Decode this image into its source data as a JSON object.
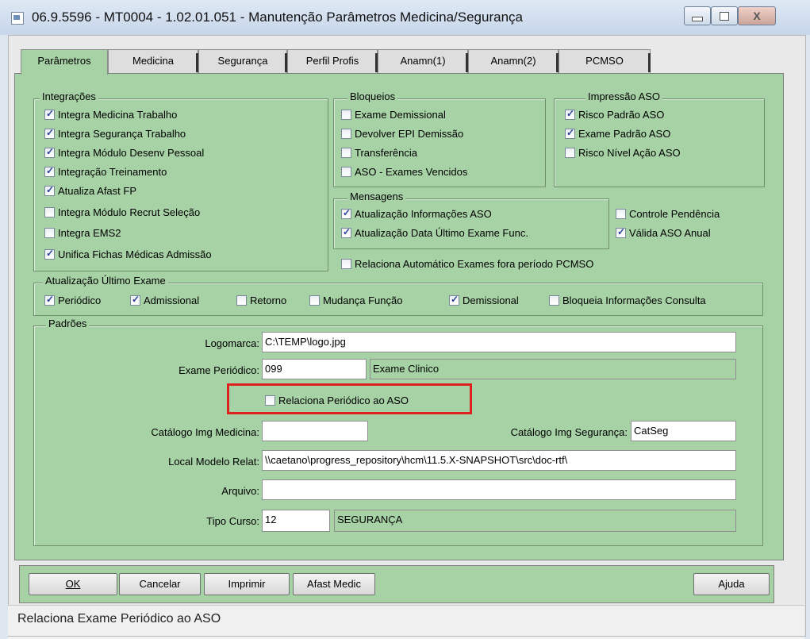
{
  "window": {
    "title": "06.9.5596 - MT0004 - 1.02.01.051 - Manutenção Parâmetros Medicina/Segurança",
    "close_glyph": "X"
  },
  "tabs": [
    "Parâmetros",
    "Medicina",
    "Segurança",
    "Perfil Profis",
    "Anamn(1)",
    "Anamn(2)",
    "PCMSO"
  ],
  "integracoes": {
    "label": "Integrações",
    "items": [
      {
        "label": "Integra Medicina Trabalho",
        "checked": true
      },
      {
        "label": "Integra Segurança Trabalho",
        "checked": true
      },
      {
        "label": "Integra Módulo Desenv Pessoal",
        "checked": true
      },
      {
        "label": "Integração Treinamento",
        "checked": true
      },
      {
        "label": "Atualiza Afast FP",
        "checked": true
      },
      {
        "label": "Integra Módulo Recrut Seleção",
        "checked": false
      },
      {
        "label": "Integra EMS2",
        "checked": false
      },
      {
        "label": "Unifica Fichas Médicas Admissão",
        "checked": true
      }
    ]
  },
  "bloqueios": {
    "label": "Bloqueios",
    "items": [
      {
        "label": "Exame Demissional",
        "checked": false
      },
      {
        "label": "Devolver EPI Demissão",
        "checked": false
      },
      {
        "label": "Transferência",
        "checked": false
      },
      {
        "label": "ASO - Exames Vencidos",
        "checked": false
      }
    ]
  },
  "impressao": {
    "label": "Impressão ASO",
    "items": [
      {
        "label": "Risco Padrão ASO",
        "checked": true
      },
      {
        "label": "Exame Padrão ASO",
        "checked": true
      },
      {
        "label": "Risco Nível Ação ASO",
        "checked": false
      }
    ]
  },
  "mensagens": {
    "label": "Mensagens",
    "items": [
      {
        "label": "Atualização Informações ASO",
        "checked": true
      },
      {
        "label": "Atualização Data Último Exame Func.",
        "checked": true
      }
    ]
  },
  "extra_checks": [
    {
      "label": "Controle Pendência",
      "checked": false
    },
    {
      "label": "Válida ASO Anual",
      "checked": true
    },
    {
      "label": "Relaciona Automático Exames fora período PCMSO",
      "checked": false
    }
  ],
  "ultimo_exame": {
    "label": "Atualização Último Exame",
    "items": [
      {
        "label": "Periódico",
        "checked": true
      },
      {
        "label": "Admissional",
        "checked": true
      },
      {
        "label": "Retorno",
        "checked": false
      },
      {
        "label": "Mudança Função",
        "checked": false
      },
      {
        "label": "Demissional",
        "checked": true
      },
      {
        "label": "Bloqueia Informações Consulta",
        "checked": false
      }
    ]
  },
  "padroes": {
    "label": "Padrões",
    "logomarca_label": "Logomarca:",
    "logomarca_value": "C:\\TEMP\\logo.jpg",
    "exame_label": "Exame Periódico:",
    "exame_code": "099",
    "exame_desc": "Exame Clinico",
    "relaciona_label": "Relaciona Periódico ao ASO",
    "relaciona_checked": false,
    "cat_med_label": "Catálogo Img Medicina:",
    "cat_med_value": "",
    "cat_seg_label": "Catálogo Img Segurança:",
    "cat_seg_value": "CatSeg",
    "local_label": "Local Modelo Relat:",
    "local_value": "\\\\caetano\\progress_repository\\hcm\\11.5.X-SNAPSHOT\\src\\doc-rtf\\",
    "arquivo_label": "Arquivo:",
    "arquivo_value": "",
    "tipo_label": "Tipo Curso:",
    "tipo_code": "12",
    "tipo_desc": "SEGURANÇA"
  },
  "buttons": {
    "ok": "OK",
    "cancelar": "Cancelar",
    "imprimir": "Imprimir",
    "afast": "Afast Medic",
    "ajuda": "Ajuda"
  },
  "status": "Relaciona Exame Periódico ao ASO",
  "colors": {
    "form_bg": "#a7d2a6",
    "highlight": "#e0201e",
    "check": "#2a3f9a"
  }
}
